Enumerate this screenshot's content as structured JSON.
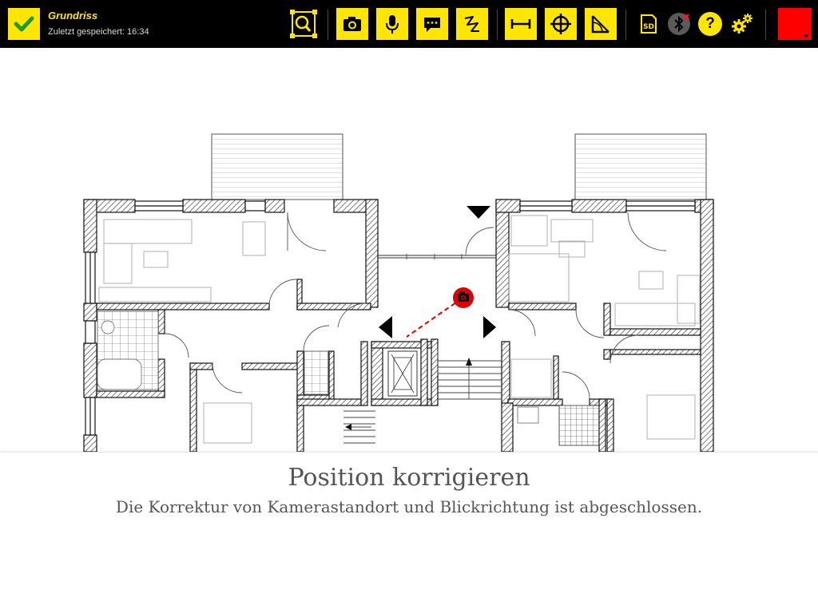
{
  "header": {
    "title": "Grundriss",
    "saved": "Zuletzt gespeichert: 16:34"
  },
  "toolbar": {
    "icons": [
      "checkmark-icon",
      "zoom-fit-icon",
      "camera-icon",
      "microphone-icon",
      "comment-icon",
      "freehand-icon",
      "measure-icon",
      "crosshair-icon",
      "angle-icon",
      "sd-card-icon",
      "bluetooth-icon",
      "help-icon",
      "settings-icon"
    ],
    "sd_label": "SD",
    "help_label": "?",
    "accent": "#ffe600",
    "color_swatch": "#ff0000"
  },
  "plan": {
    "camera_marker_color": "#e00000"
  },
  "panel": {
    "title": "Position korrigieren",
    "text": "Die Korrektur von Kamerastandort und Blickrichtung ist abgeschlossen."
  }
}
